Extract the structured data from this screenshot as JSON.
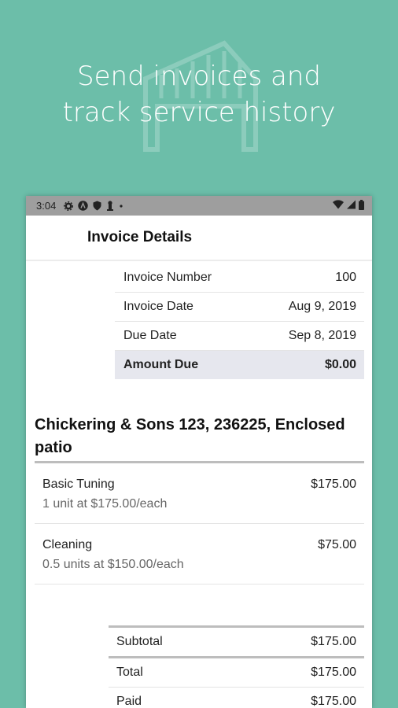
{
  "promo": {
    "line1": "Send invoices and",
    "line2": "track service history"
  },
  "status_bar": {
    "time": "3:04",
    "icons": [
      "settings-icon",
      "a-circle-icon",
      "shield-icon",
      "piano-icon",
      "dot-icon"
    ],
    "right_icons": [
      "wifi-icon",
      "cell-signal-icon",
      "battery-icon"
    ]
  },
  "app_bar": {
    "title": "Invoice Details"
  },
  "summary": [
    {
      "label": "Invoice Number",
      "value": "100"
    },
    {
      "label": "Invoice Date",
      "value": "Aug 9, 2019"
    },
    {
      "label": "Due Date",
      "value": "Sep 8, 2019"
    },
    {
      "label": "Amount Due",
      "value": "$0.00"
    }
  ],
  "equipment": {
    "title": "Chickering & Sons 123, 236225, Enclosed patio"
  },
  "line_items": [
    {
      "name": "Basic Tuning",
      "detail": "1 unit at $175.00/each",
      "amount": "$175.00"
    },
    {
      "name": "Cleaning",
      "detail": "0.5 units at $150.00/each",
      "amount": "$75.00"
    }
  ],
  "totals": [
    {
      "label": "Subtotal",
      "value": "$175.00"
    },
    {
      "label": "Total",
      "value": "$175.00"
    },
    {
      "label": "Paid",
      "value": "$175.00"
    }
  ]
}
